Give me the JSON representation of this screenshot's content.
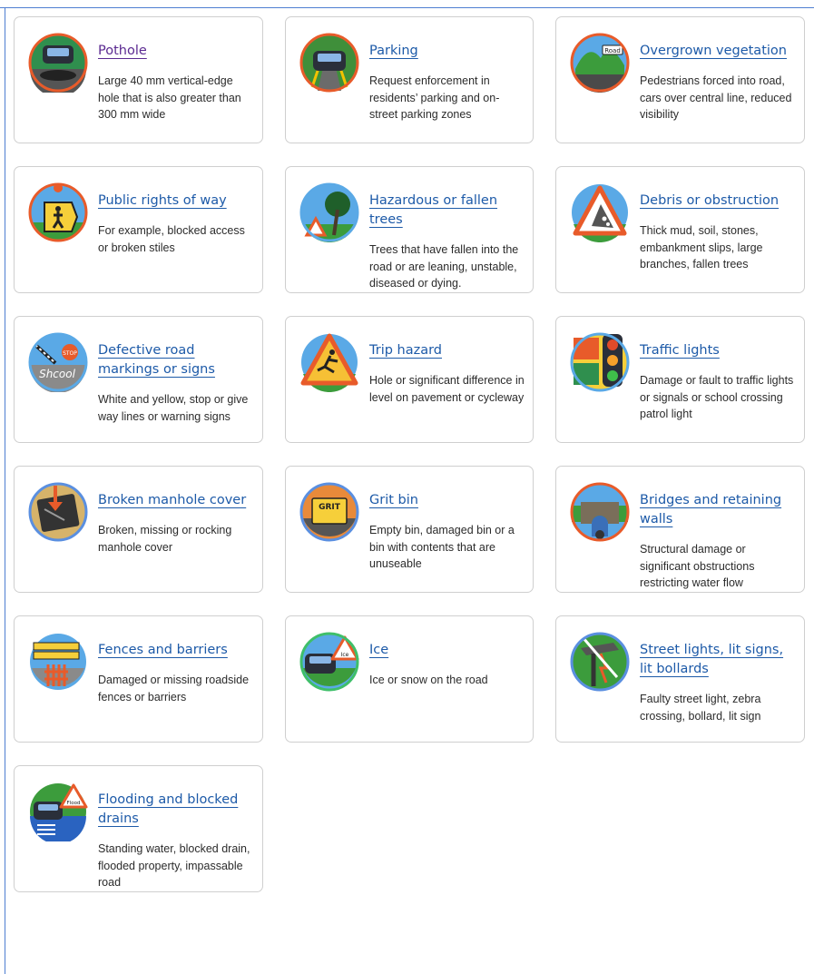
{
  "cards": [
    {
      "title": "Pothole",
      "desc": "Large 40 mm vertical-edge hole that is also greater than 300 mm wide",
      "icon": "pothole-icon"
    },
    {
      "title": "Parking",
      "desc": "Request enforcement in residents’ parking and on-street parking zones",
      "icon": "parking-icon"
    },
    {
      "title": "Overgrown vegetation",
      "desc": "Pedestrians forced into road, cars over central line, reduced visibility",
      "icon": "vegetation-icon",
      "sign_text": "Road"
    },
    {
      "title": "Public rights of way",
      "desc": "For example, blocked access or broken stiles",
      "icon": "rights-of-way-icon"
    },
    {
      "title": "Hazardous or fallen trees",
      "desc": "Trees that have fallen into the road or are leaning, unstable, diseased or dying.",
      "icon": "fallen-tree-icon"
    },
    {
      "title": "Debris or obstruction",
      "desc": "Thick mud, soil, stones, embankment slips, large branches, fallen trees",
      "icon": "debris-icon"
    },
    {
      "title": "Defective road markings or signs",
      "desc": "White and yellow, stop or give way lines or warning signs",
      "icon": "road-markings-icon",
      "sign_text": "Shcool",
      "stop_text": "STOP"
    },
    {
      "title": "Trip hazard",
      "desc": "Hole or significant difference in level on pavement or cycleway",
      "icon": "trip-hazard-icon"
    },
    {
      "title": "Traffic lights",
      "desc": "Damage or fault to traffic lights or signals or school crossing patrol light",
      "icon": "traffic-lights-icon"
    },
    {
      "title": "Broken manhole cover",
      "desc": "Broken, missing or rocking manhole cover",
      "icon": "manhole-icon"
    },
    {
      "title": "Grit bin",
      "desc": "Empty bin, damaged bin or a bin with contents that are unuseable",
      "icon": "grit-bin-icon",
      "sign_text": "GRIT"
    },
    {
      "title": "Bridges and retaining walls",
      "desc": "Structural damage or significant obstructions restricting water flow",
      "icon": "bridge-icon"
    },
    {
      "title": "Fences and barriers",
      "desc": "Damaged or missing roadside fences or barriers",
      "icon": "fence-icon"
    },
    {
      "title": "Ice",
      "desc": "Ice or snow on the road",
      "icon": "ice-icon",
      "sign_text": "Ice"
    },
    {
      "title": "Street lights, lit signs, lit bollards",
      "desc": "Faulty street light, zebra crossing, bollard, lit sign",
      "icon": "street-light-icon"
    },
    {
      "title": "Flooding and blocked drains",
      "desc": "Standing water, blocked drain, flooded property, impassable road",
      "icon": "flooding-icon",
      "sign_text": "Flood"
    }
  ],
  "colors": {
    "link": "#1d5aa8",
    "visited_link": "#5b2a91",
    "border": "#cfcfcf"
  }
}
